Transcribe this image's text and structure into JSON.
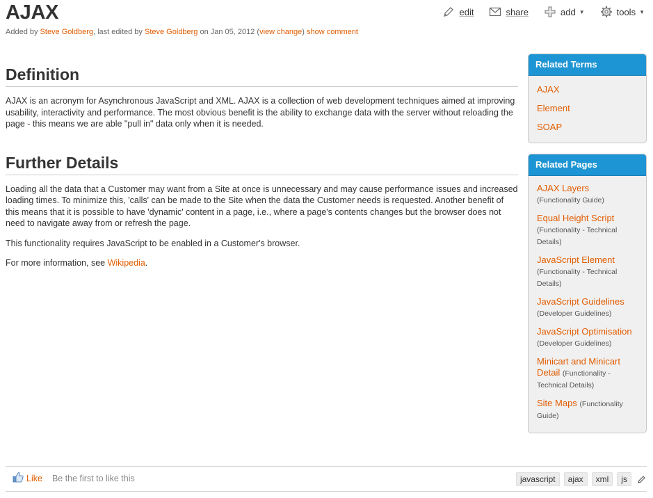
{
  "page": {
    "title": "AJAX",
    "byline": {
      "added_by_prefix": "Added by ",
      "author": "Steve Goldberg",
      "edited_prefix": ", last edited by ",
      "editor": "Steve Goldberg",
      "date_text": " on Jan 05, 2012  (",
      "view_change": "view change",
      "close_paren": ")  ",
      "show_comment": "show comment"
    }
  },
  "actions": {
    "edit": {
      "label": "edit",
      "icon": "pencil-icon"
    },
    "share": {
      "label": "share",
      "icon": "envelope-icon"
    },
    "add": {
      "label": "add",
      "icon": "plus-icon"
    },
    "tools": {
      "label": "tools",
      "icon": "gear-icon"
    }
  },
  "content": {
    "definition": {
      "heading": "Definition",
      "text": "AJAX is an acronym for Asynchronous JavaScript and XML. AJAX is a collection of web development techniques aimed at improving usability, interactivity and performance. The most obvious benefit is the ability to exchange data with the server without reloading the page - this means we are able \"pull in\" data only when it is needed."
    },
    "details": {
      "heading": "Further Details",
      "p1": "Loading all the data that a Customer may want from a Site at once is unnecessary and may cause performance issues and increased loading times. To minimize this, 'calls' can be made to the Site when the data the Customer needs is requested. Another benefit of this means that it is possible to have 'dynamic' content in a page, i.e., where a page's contents changes but the browser does not need to navigate away from or refresh the page.",
      "p2": "This functionality requires JavaScript to be enabled in a Customer's browser.",
      "p3_prefix": "For more information, see ",
      "p3_link": "Wikipedia",
      "p3_suffix": "."
    }
  },
  "related_terms": {
    "heading": "Related Terms",
    "items": [
      "AJAX",
      "Element",
      "SOAP"
    ]
  },
  "related_pages": {
    "heading": "Related Pages",
    "items": [
      {
        "title": "AJAX Layers",
        "category": "(Functionality Guide)"
      },
      {
        "title": "Equal Height Script",
        "category": "(Functionality - Technical Details)"
      },
      {
        "title": "JavaScript Element",
        "category": "(Functionality - Technical Details)"
      },
      {
        "title": "JavaScript Guidelines",
        "category": "(Developer Guidelines)"
      },
      {
        "title": "JavaScript Optimisation",
        "category": "(Developer Guidelines)"
      },
      {
        "title": "Minicart and Minicart Detail",
        "category": "(Functionality - Technical Details)"
      },
      {
        "title": "Site Maps",
        "category": "(Functionality Guide)"
      }
    ]
  },
  "footer": {
    "like_label": "Like",
    "like_status": "Be the first to like this",
    "tags": [
      "javascript",
      "ajax",
      "xml",
      "js"
    ]
  },
  "colors": {
    "link": "#e25c00",
    "sidebar_header": "#1d94d3",
    "sidebar_bg": "#f0f0f0"
  }
}
